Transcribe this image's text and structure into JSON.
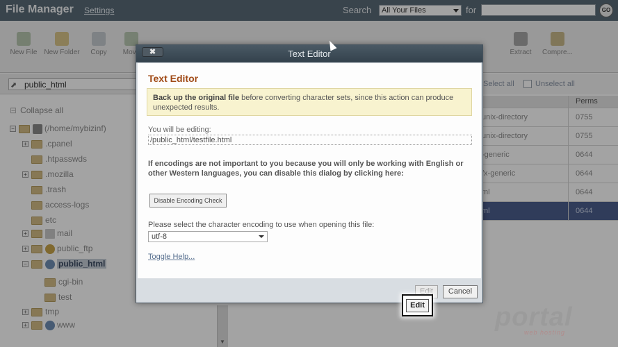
{
  "header": {
    "title": "File Manager",
    "settings_link": "Settings",
    "search_label": "Search",
    "search_scope": "All Your Files",
    "for_label": "for",
    "search_value": "",
    "go_label": "GO"
  },
  "toolbar": {
    "items": [
      {
        "label": "New File",
        "icon": "new-file-icon"
      },
      {
        "label": "New Folder",
        "icon": "new-folder-icon"
      },
      {
        "label": "Copy",
        "icon": "copy-icon"
      },
      {
        "label": "Move",
        "icon": "move-icon"
      },
      {
        "label": "Extract",
        "icon": "extract-icon"
      },
      {
        "label": "Compre...",
        "icon": "compress-icon"
      }
    ]
  },
  "left_pane": {
    "path": "public_html",
    "collapse_all": "Collapse all",
    "tree": [
      {
        "label": "(/home/mybizinf)",
        "icon": "home-icon"
      },
      {
        "label": ".cpanel"
      },
      {
        "label": ".htpasswds"
      },
      {
        "label": ".mozilla"
      },
      {
        "label": ".trash"
      },
      {
        "label": "access-logs"
      },
      {
        "label": "etc"
      },
      {
        "label": "mail",
        "icon": "mail-icon"
      },
      {
        "label": "public_ftp",
        "icon": "ftp-icon"
      },
      {
        "label": "public_html",
        "icon": "globe-icon"
      },
      {
        "label": "cgi-bin"
      },
      {
        "label": "test"
      },
      {
        "label": "tmp"
      },
      {
        "label": "www",
        "icon": "globe-icon"
      }
    ]
  },
  "right_pane": {
    "select_all": "Select all",
    "unselect_all": "Unselect all",
    "perms_header": "Perms",
    "rows": [
      {
        "type": "unix-directory",
        "perms": "0755"
      },
      {
        "type": "unix-directory",
        "perms": "0755"
      },
      {
        "type": "-generic",
        "perms": "0644"
      },
      {
        "type": "/x-generic",
        "perms": "0644"
      },
      {
        "type": "ml",
        "perms": "0644"
      },
      {
        "type": "ml",
        "perms": "0644"
      }
    ]
  },
  "dialog": {
    "close_label": "✖",
    "title": "Text Editor",
    "heading": "Text Editor",
    "warning_bold": "Back up the original file",
    "warning_rest": " before converting character sets, since this action can produce unexpected results.",
    "editing_label": "You will be editing:",
    "editing_path": "/public_html/testfile.html",
    "encoding_note": "If encodings are not important to you because you will only be working with English or other Western languages, you can disable this dialog by clicking here:",
    "disable_button": "Disable Encoding Check",
    "encoding_select_label": "Please select the character encoding to use when opening this file:",
    "encoding_value": "utf-8",
    "toggle_help": "Toggle Help...",
    "edit_button": "Edit",
    "cancel_button": "Cancel"
  },
  "highlight": {
    "edit_button": "Edit"
  },
  "watermark": {
    "brand": "portal",
    "sub": "web hosting"
  }
}
